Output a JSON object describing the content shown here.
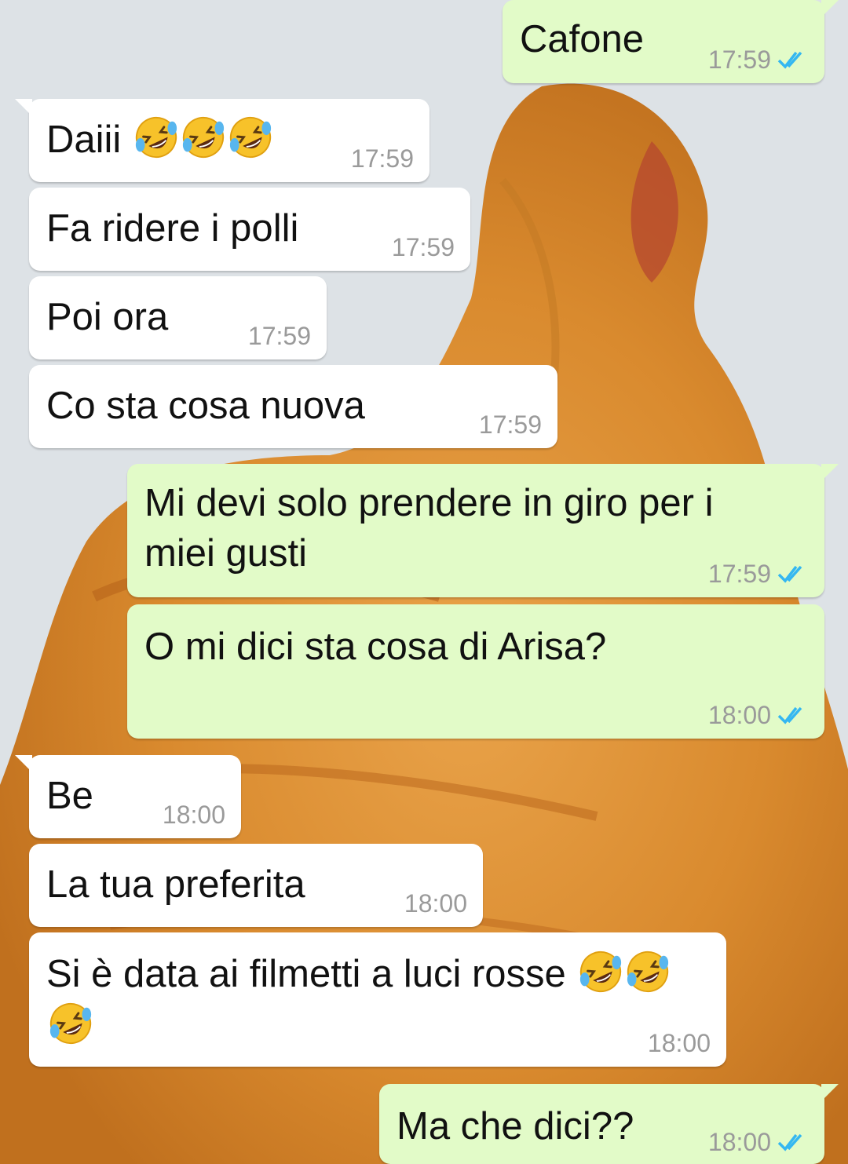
{
  "colors": {
    "incoming_bubble": "#ffffff",
    "outgoing_bubble": "#e2fbc8",
    "timestamp": "#9a9a9a",
    "read_ticks": "#34b7f1"
  },
  "messages": [
    {
      "dir": "out",
      "text": "Cafone",
      "time": "17:59",
      "read": true
    },
    {
      "dir": "in",
      "text": "Daiii",
      "emoji_after": 3,
      "time": "17:59"
    },
    {
      "dir": "in",
      "text": "Fa ridere i polli",
      "time": "17:59"
    },
    {
      "dir": "in",
      "text": "Poi ora",
      "time": "17:59"
    },
    {
      "dir": "in",
      "text": "Co sta cosa nuova",
      "time": "17:59"
    },
    {
      "dir": "out",
      "text": "Mi devi solo prendere in giro per i miei gusti",
      "time": "17:59",
      "read": true
    },
    {
      "dir": "out",
      "text": "O mi dici sta cosa di Arisa?",
      "time": "18:00",
      "read": true
    },
    {
      "dir": "in",
      "text": "Be",
      "time": "18:00"
    },
    {
      "dir": "in",
      "text": "La tua preferita",
      "time": "18:00"
    },
    {
      "dir": "in",
      "text": "Si è data ai filmetti a luci rosse",
      "emoji_after": 3,
      "time": "18:00"
    },
    {
      "dir": "out",
      "text": "Ma che dici??",
      "time": "18:00",
      "read": true
    }
  ],
  "icons": {
    "read_receipt": "double-check-icon",
    "emoji": "rolling-on-floor-laughing-emoji"
  }
}
